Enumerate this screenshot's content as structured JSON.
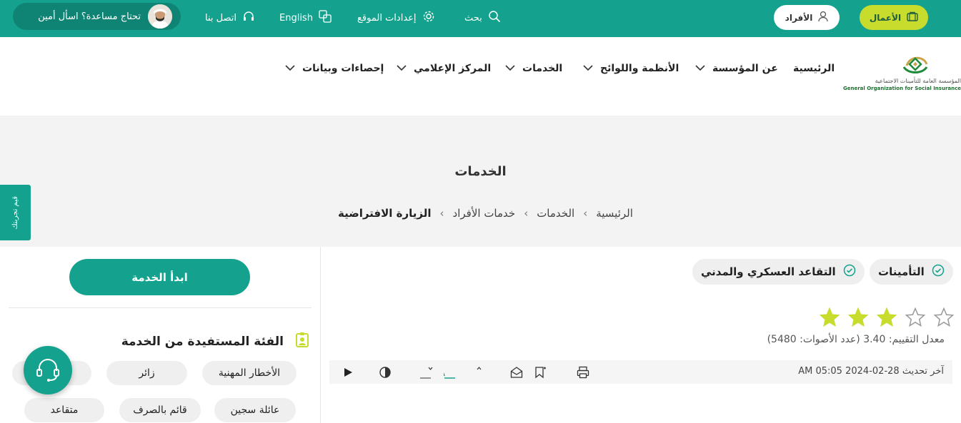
{
  "topbar": {
    "business_label": "الأعمال",
    "individuals_label": "الأفراد",
    "search_label": "بحث",
    "settings_label": "إعدادات الموقع",
    "language_label": "English",
    "contact_label": "اتصل بنا",
    "help_label": "تحتاج مساعدة؟ اسأل أمين"
  },
  "logo": {
    "arabic": "المؤسسة العامة للتأمينات الاجتماعية",
    "english": "General Organization for Social Insurance"
  },
  "nav": {
    "items": [
      {
        "label": "الرئيسية"
      },
      {
        "label": "عن المؤسسة"
      },
      {
        "label": "الأنظمة واللوائح"
      },
      {
        "label": "الخدمات"
      },
      {
        "label": "المركز الإعلامي"
      },
      {
        "label": "إحصاءات وبيانات"
      }
    ]
  },
  "hero": {
    "title": "الخدمات",
    "breadcrumb": [
      "الرئيسية",
      "الخدمات",
      "خدمات الأفراد",
      "الزيارة الافتراضية"
    ]
  },
  "side_tab": {
    "label": "قيم تجربتك"
  },
  "categories": [
    "التأمينات",
    "التقاعد العسكري والمدني"
  ],
  "rating": {
    "stars_filled": 3,
    "stars_total": 5,
    "text": "معدل التقييم: 3.40 (عدد الأصوات: 5480)"
  },
  "toolbar": {
    "updated": "آخر تحديث 28-02-2024 05:05 AM"
  },
  "service": {
    "start_label": "ابدأ الخدمة",
    "beneficiary_title": "الفئة المستفيدة من الخدمة",
    "tags": [
      "الأخطار المهنية",
      "زائر",
      "عائلة سجين",
      "قائم بالصرف",
      "متقاعد"
    ]
  },
  "colors": {
    "primary": "#14a28e",
    "accent": "#c8dc2e",
    "star": "#c8dc2e"
  }
}
